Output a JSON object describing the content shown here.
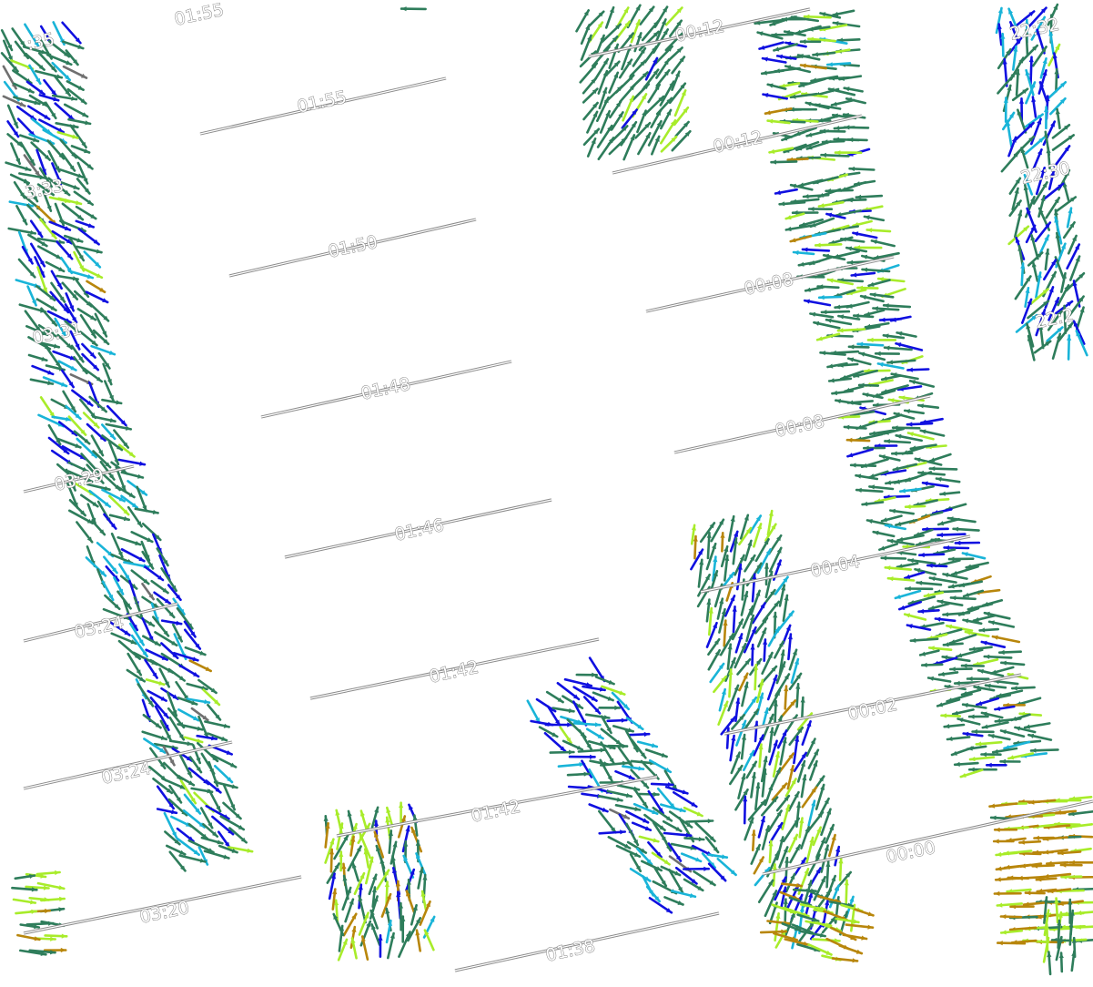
{
  "colors": {
    "background": "#ffffff",
    "track_outline": "#8a8a8a",
    "arrow_palette": [
      "#2e7d5b",
      "#1010e0",
      "#19b4d8",
      "#a8ec2a",
      "#b8860b",
      "#707070"
    ]
  },
  "time_labels": {
    "s1_a": "01:55",
    "s1_b": "01:55",
    "s1_c": "01:50",
    "s1_d": "01:48",
    "s1_e": "01:46",
    "s1_f": "01:42",
    "s1_g": "01:42",
    "s1_h": "01:38",
    "s2_a": "00:12",
    "s2_b": "00:12",
    "s2_c": "00:08",
    "s2_d": "00:08",
    "s2_e": "00:04",
    "s2_f": "00:02",
    "s2_g": "00:00",
    "s3_a": ":35",
    "s3_b": "3:33",
    "s3_c": "03:31",
    "s3_d": "03:29",
    "s3_e": "03:24",
    "s3_f": "03:24",
    "s3_g": "03:20",
    "s4_a": "22:32",
    "s4_b": "22:30",
    "s4_c": "22:2"
  }
}
